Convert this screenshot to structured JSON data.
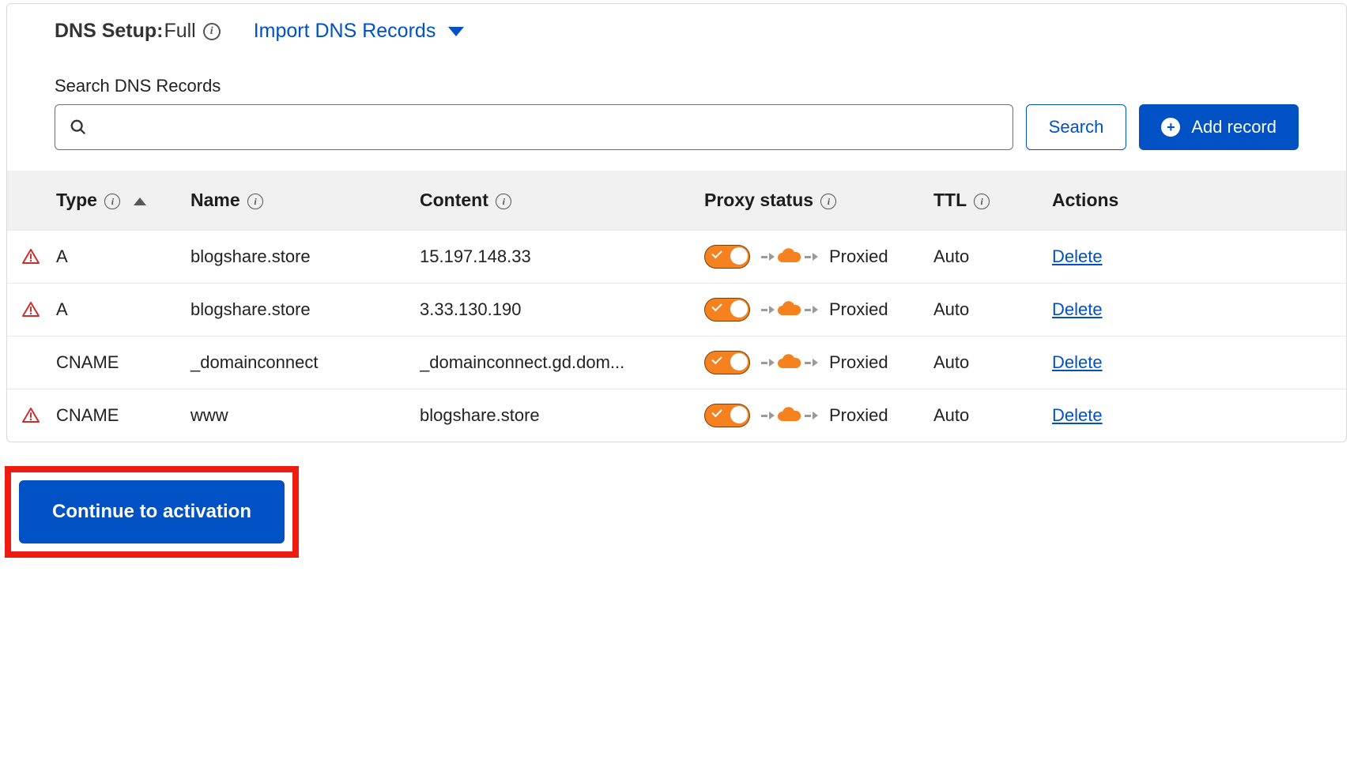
{
  "dns_setup": {
    "label": "DNS Setup:",
    "value": "Full",
    "import_link": "Import DNS Records"
  },
  "search": {
    "label": "Search DNS Records",
    "button": "Search",
    "add_button": "Add record"
  },
  "columns": {
    "type": "Type",
    "name": "Name",
    "content": "Content",
    "proxy": "Proxy status",
    "ttl": "TTL",
    "actions": "Actions"
  },
  "proxied_label": "Proxied",
  "delete_label": "Delete",
  "rows": [
    {
      "warning": true,
      "type": "A",
      "name": "blogshare.store",
      "content": "15.197.148.33",
      "proxy": true,
      "ttl": "Auto"
    },
    {
      "warning": true,
      "type": "A",
      "name": "blogshare.store",
      "content": "3.33.130.190",
      "proxy": true,
      "ttl": "Auto"
    },
    {
      "warning": false,
      "type": "CNAME",
      "name": "_domainconnect",
      "content": "_domainconnect.gd.dom...",
      "proxy": true,
      "ttl": "Auto"
    },
    {
      "warning": true,
      "type": "CNAME",
      "name": "www",
      "content": "blogshare.store",
      "proxy": true,
      "ttl": "Auto"
    }
  ],
  "continue_button": "Continue to activation"
}
